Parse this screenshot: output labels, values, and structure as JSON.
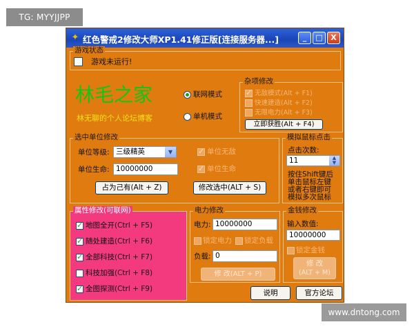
{
  "watermarks": {
    "top": "TG: MYYJJPP",
    "bottom": "www.dntong.com"
  },
  "window": {
    "title": "红色警戒2修改大师XP1.41修正版[连接服务器...]",
    "controls": {
      "minimize": "_",
      "maximize": "□",
      "close": "X"
    }
  },
  "game_status": {
    "label": "游戏状态",
    "checkbox_label": "游戏未运行!"
  },
  "brand": {
    "title": "林毛之家",
    "subtitle": "林无聊的个人论坛博客",
    "title_color": "#16c416",
    "subtitle_color": "#f2e21a"
  },
  "mode": {
    "online_label": "联网模式",
    "single_label": "单机模式"
  },
  "misc": {
    "label": "杂项修改",
    "items": [
      "无敌模式(Alt + F1)",
      "快速建造(Alt + F2)",
      "无限电力(Alt + F3)"
    ],
    "win_button": "立即获胜(Alt + F4)"
  },
  "unit": {
    "label": "选中单位修改",
    "level_label": "单位等级:",
    "level_value": "三级精英",
    "health_label": "单位生命:",
    "health_value": "10000000",
    "check1": "单位无敌",
    "check2": "单位生命",
    "occupy_button": "占为己有(Alt + Z)",
    "modify_button": "修改选中(ALT + S)"
  },
  "mouse": {
    "label": "模拟鼠标点击",
    "count_label": "点击次数:",
    "count_value": "11",
    "hint": [
      "按住Shift键后",
      "单击鼠标左键",
      "或者右键即可",
      "模拟多次鼠标"
    ]
  },
  "attr": {
    "label": "属性修改(可联网)",
    "items": [
      {
        "label": "地图全开(Ctrl + F5)",
        "checked": true
      },
      {
        "label": "随处建造(Ctrl + F6)",
        "checked": true
      },
      {
        "label": "全部科技(Ctrl + F7)",
        "checked": true
      },
      {
        "label": "科技加强(Ctrl + F8)",
        "checked": false
      },
      {
        "label": "全图探测(Ctrl + F9)",
        "checked": true
      }
    ]
  },
  "power": {
    "label": "电力修改",
    "power_label": "电力:",
    "power_value": "10000000",
    "lock1": "锁定电力",
    "lock2": "锁定负载",
    "load_label": "负载:",
    "load_value": "0",
    "modify_button": "修 改(ALT + P)"
  },
  "money": {
    "label": "金钱修改",
    "input_label": "输入数值:",
    "input_value": "10000000",
    "lock": "锁定金钱",
    "modify_button_line1": "修 改",
    "modify_button_line2": "(ALT + M)"
  },
  "footer": {
    "help_button": "说明",
    "forum_button": "官方论坛"
  }
}
